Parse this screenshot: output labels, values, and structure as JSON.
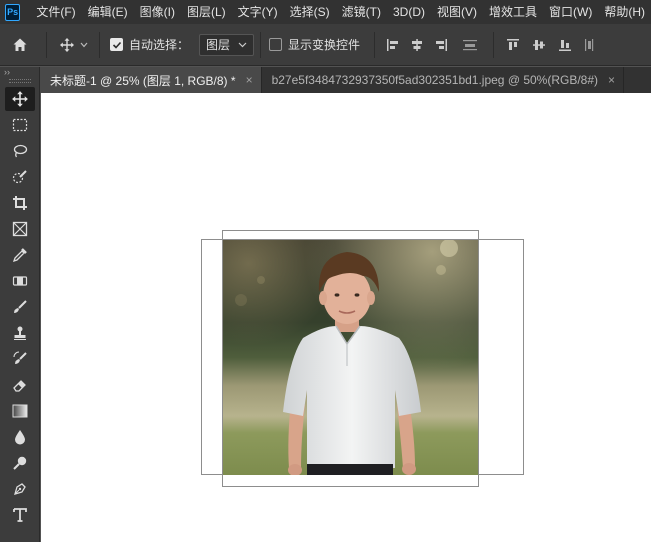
{
  "app": {
    "logo_text": "Ps"
  },
  "menu": [
    "文件(F)",
    "编辑(E)",
    "图像(I)",
    "图层(L)",
    "文字(Y)",
    "选择(S)",
    "滤镜(T)",
    "3D(D)",
    "视图(V)",
    "增效工具",
    "窗口(W)",
    "帮助(H)"
  ],
  "options": {
    "auto_select_label": "自动选择：",
    "auto_select_checked": true,
    "auto_select_target": "图层",
    "show_transform_label": "显示变换控件",
    "show_transform_checked": false
  },
  "tabs": [
    {
      "title": "未标题-1 @ 25% (图层 1, RGB/8) *",
      "close": "×",
      "active": true
    },
    {
      "title": "b27e5f3484732937350f5ad302351bd1.jpeg @ 50%(RGB/8#)",
      "close": "×",
      "active": false
    }
  ],
  "toolbar": {
    "collapse": "››",
    "tools": [
      "move-tool",
      "marquee-tool",
      "lasso-tool",
      "quick-selection-tool",
      "crop-tool",
      "frame-tool",
      "eyedropper-tool",
      "healing-brush-tool",
      "brush-tool",
      "clone-stamp-tool",
      "history-brush-tool",
      "eraser-tool",
      "gradient-tool",
      "blur-tool",
      "dodge-tool",
      "pen-tool",
      "type-tool"
    ]
  },
  "colors": {
    "app_bg": "#535353",
    "menubar": "#323232",
    "panel": "#3c3c3c",
    "canvas": "#ffffff",
    "accent": "#31a8ff"
  }
}
